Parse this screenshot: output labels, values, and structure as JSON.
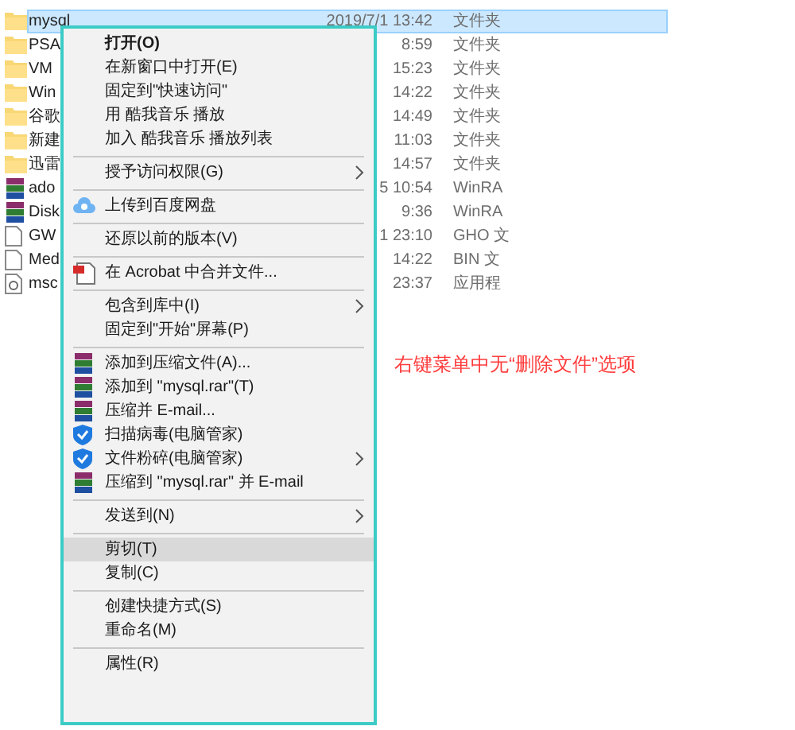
{
  "files": [
    {
      "name": "mysql",
      "date": "2019/7/1 13:42",
      "type": "文件夹",
      "kind": "folder",
      "selected": true
    },
    {
      "name": "PSA",
      "date": "8:59",
      "type": "文件夹",
      "kind": "folder",
      "selected": false
    },
    {
      "name": "VM",
      "date": "15:23",
      "type": "文件夹",
      "kind": "folder",
      "selected": false
    },
    {
      "name": "Win",
      "date": "14:22",
      "type": "文件夹",
      "kind": "folder",
      "selected": false
    },
    {
      "name": "谷歌",
      "date": "14:49",
      "type": "文件夹",
      "kind": "folder",
      "selected": false
    },
    {
      "name": "新建",
      "date": "11:03",
      "type": "文件夹",
      "kind": "folder",
      "selected": false
    },
    {
      "name": "迅雷",
      "date": "14:57",
      "type": "文件夹",
      "kind": "folder",
      "selected": false
    },
    {
      "name": "ado",
      "date": "5 10:54",
      "type": "WinRA",
      "kind": "archive",
      "selected": false
    },
    {
      "name": "Disk",
      "date": "9:36",
      "type": "WinRA",
      "kind": "archive",
      "selected": false
    },
    {
      "name": "GW",
      "date": "1 23:10",
      "type": "GHO 文",
      "kind": "file",
      "selected": false
    },
    {
      "name": "Med",
      "date": "14:22",
      "type": "BIN 文",
      "kind": "file",
      "selected": false
    },
    {
      "name": "msc",
      "date": "23:37",
      "type": "应用程",
      "kind": "setup",
      "selected": false
    }
  ],
  "context_menu": [
    {
      "kind": "plain",
      "label": "打开(O)",
      "bold": true,
      "submenu": false,
      "selected": false
    },
    {
      "kind": "plain",
      "label": "在新窗口中打开(E)",
      "bold": false,
      "submenu": false,
      "selected": false
    },
    {
      "kind": "plain",
      "label": "固定到\"快速访问\"",
      "bold": false,
      "submenu": false,
      "selected": false
    },
    {
      "kind": "plain",
      "label": "用 酷我音乐 播放",
      "bold": false,
      "submenu": false,
      "selected": false
    },
    {
      "kind": "plain",
      "label": "加入 酷我音乐 播放列表",
      "bold": false,
      "submenu": false,
      "selected": false
    },
    {
      "kind": "separator"
    },
    {
      "kind": "plain",
      "label": "授予访问权限(G)",
      "bold": false,
      "submenu": true,
      "selected": false
    },
    {
      "kind": "separator"
    },
    {
      "kind": "cloud",
      "label": "上传到百度网盘",
      "bold": false,
      "submenu": false,
      "selected": false
    },
    {
      "kind": "separator"
    },
    {
      "kind": "plain",
      "label": "还原以前的版本(V)",
      "bold": false,
      "submenu": false,
      "selected": false
    },
    {
      "kind": "separator"
    },
    {
      "kind": "acrobat",
      "label": "在 Acrobat 中合并文件...",
      "bold": false,
      "submenu": false,
      "selected": false
    },
    {
      "kind": "separator"
    },
    {
      "kind": "plain",
      "label": "包含到库中(I)",
      "bold": false,
      "submenu": true,
      "selected": false
    },
    {
      "kind": "plain",
      "label": "固定到\"开始\"屏幕(P)",
      "bold": false,
      "submenu": false,
      "selected": false
    },
    {
      "kind": "separator"
    },
    {
      "kind": "archive",
      "label": "添加到压缩文件(A)...",
      "bold": false,
      "submenu": false,
      "selected": false
    },
    {
      "kind": "archive",
      "label": "添加到 \"mysql.rar\"(T)",
      "bold": false,
      "submenu": false,
      "selected": false
    },
    {
      "kind": "archive",
      "label": "压缩并 E-mail...",
      "bold": false,
      "submenu": false,
      "selected": false
    },
    {
      "kind": "shield",
      "label": "扫描病毒(电脑管家)",
      "bold": false,
      "submenu": false,
      "selected": false
    },
    {
      "kind": "shield",
      "label": "文件粉碎(电脑管家)",
      "bold": false,
      "submenu": true,
      "selected": false
    },
    {
      "kind": "archive",
      "label": "压缩到 \"mysql.rar\" 并 E-mail",
      "bold": false,
      "submenu": false,
      "selected": false
    },
    {
      "kind": "separator"
    },
    {
      "kind": "plain",
      "label": "发送到(N)",
      "bold": false,
      "submenu": true,
      "selected": false
    },
    {
      "kind": "separator"
    },
    {
      "kind": "plain",
      "label": "剪切(T)",
      "bold": false,
      "submenu": false,
      "selected": true
    },
    {
      "kind": "plain",
      "label": "复制(C)",
      "bold": false,
      "submenu": false,
      "selected": false
    },
    {
      "kind": "separator"
    },
    {
      "kind": "plain",
      "label": "创建快捷方式(S)",
      "bold": false,
      "submenu": false,
      "selected": false
    },
    {
      "kind": "plain",
      "label": "重命名(M)",
      "bold": false,
      "submenu": false,
      "selected": false
    },
    {
      "kind": "separator"
    },
    {
      "kind": "plain",
      "label": "属性(R)",
      "bold": false,
      "submenu": false,
      "selected": false
    }
  ],
  "annotation": "右键菜单中无“删除文件”选项"
}
